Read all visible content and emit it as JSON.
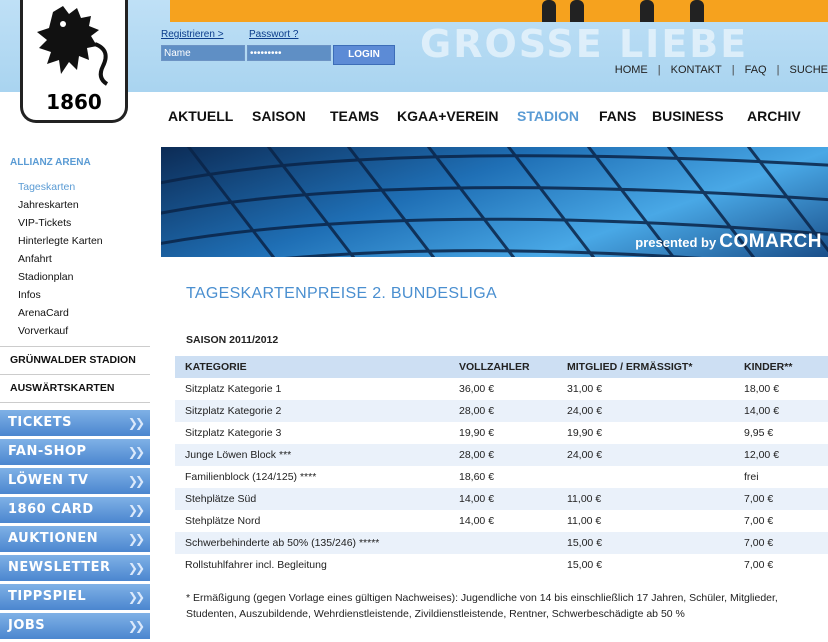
{
  "header": {
    "register_link": "Registrieren >",
    "password_link": "Passwort ?",
    "name_value": "Name",
    "password_value": "•••••••••",
    "login_label": "LOGIN",
    "background_text": "GROSSE LIEBE",
    "logo_text": "1860",
    "util_nav": [
      "HOME",
      "KONTAKT",
      "FAQ",
      "SUCHE"
    ]
  },
  "main_nav": [
    "AKTUELL",
    "SAISON",
    "TEAMS",
    "KGAA+VEREIN",
    "STADION",
    "FANS",
    "BUSINESS",
    "ARCHIV"
  ],
  "main_nav_active": "STADION",
  "sidebar": {
    "section_title": "ALLIANZ ARENA",
    "sub_items": [
      "Tageskarten",
      "Jahreskarten",
      "VIP-Tickets",
      "Hinterlegte Karten",
      "Anfahrt",
      "Stadionplan",
      "Infos",
      "ArenaCard",
      "Vorverkauf"
    ],
    "active_sub": "Tageskarten",
    "headings": [
      "GRÜNWALDER STADION",
      "AUSWÄRTSKARTEN"
    ],
    "big_nav": [
      "TICKETS",
      "FAN-SHOP",
      "LÖWEN TV",
      "1860 CARD",
      "AUKTIONEN",
      "NEWSLETTER",
      "TIPPSPIEL",
      "JOBS"
    ]
  },
  "hero": {
    "presented_by": "presented by",
    "brand": "COMARCH"
  },
  "content": {
    "title": "TAGESKARTENPREISE 2. BUNDESLIGA",
    "season": "SAISON 2011/2012",
    "columns": [
      "KATEGORIE",
      "VOLLZAHLER",
      "MITGLIED / ERMÄSSIGT*",
      "KINDER**"
    ],
    "rows": [
      [
        "Sitzplatz Kategorie 1",
        "36,00 €",
        "31,00 €",
        "18,00 €"
      ],
      [
        "Sitzplatz Kategorie 2",
        "28,00 €",
        "24,00 €",
        "14,00 €"
      ],
      [
        "Sitzplatz Kategorie 3",
        "19,90 €",
        "19,90 €",
        "9,95 €"
      ],
      [
        "Junge Löwen Block ***",
        "28,00 €",
        "24,00 €",
        "12,00 €"
      ],
      [
        "Familienblock (124/125) ****",
        "18,60 €",
        "",
        "frei"
      ],
      [
        "Stehplätze Süd",
        "14,00 €",
        "11,00 €",
        "7,00 €"
      ],
      [
        "Stehplätze Nord",
        "14,00 €",
        "11,00 €",
        "7,00 €"
      ],
      [
        "Schwerbehinderte ab 50% (135/246) *****",
        "",
        "15,00 €",
        "7,00 €"
      ],
      [
        "Rollstuhlfahrer incl. Begleitung",
        "",
        "15,00 €",
        "7,00 €"
      ]
    ],
    "footnote": "* Ermäßigung (gegen Vorlage eines gültigen Nachweises): Jugendliche von 14 bis einschließlich 17 Jahren, Schüler, Mitglieder, Studenten, Auszubildende, Wehrdienstleistende, Zivildienstleistende, Rentner, Schwerbeschädigte ab 50 %"
  },
  "colors": {
    "accent": "#5a9bd4",
    "banner_orange": "#f6a21e",
    "table_header": "#cddff3"
  }
}
